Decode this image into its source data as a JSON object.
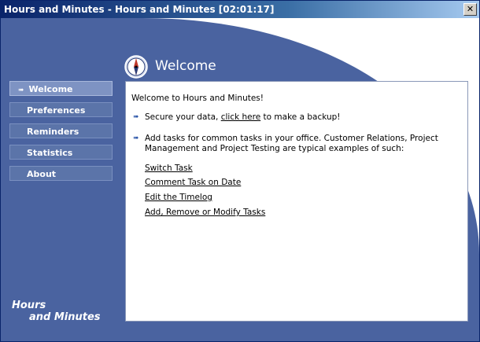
{
  "window": {
    "title": "Hours and Minutes - Hours and Minutes [02:01:17]",
    "close_glyph": "✕"
  },
  "header": {
    "title": "Welcome",
    "icon": "compass-icon"
  },
  "sidebar": {
    "active_arrow": "➠",
    "items": [
      {
        "label": "Welcome"
      },
      {
        "label": "Preferences"
      },
      {
        "label": "Reminders"
      },
      {
        "label": "Statistics"
      },
      {
        "label": "About"
      }
    ]
  },
  "brand": {
    "line1": "Hours",
    "line2": "and Minutes"
  },
  "content": {
    "greeting": "Welcome to Hours and Minutes!",
    "bullet_glyph": "➠",
    "backup": {
      "prefix": "Secure your data, ",
      "link": "click here",
      "suffix": " to make a backup!"
    },
    "tasks_intro": "Add tasks for common tasks in your office. Customer Relations, Project Management and Project Testing are typical examples of such:",
    "links": [
      {
        "label": "Switch Task"
      },
      {
        "label": "Comment Task on Date"
      },
      {
        "label": "Edit the Timelog"
      },
      {
        "label": "Add, Remove or Modify Tasks"
      }
    ]
  },
  "colors": {
    "titlebar_start": "#0a246a",
    "background_blue": "#4a63a0",
    "nav_item": "#5b74a9",
    "nav_active": "#7e93c3"
  }
}
